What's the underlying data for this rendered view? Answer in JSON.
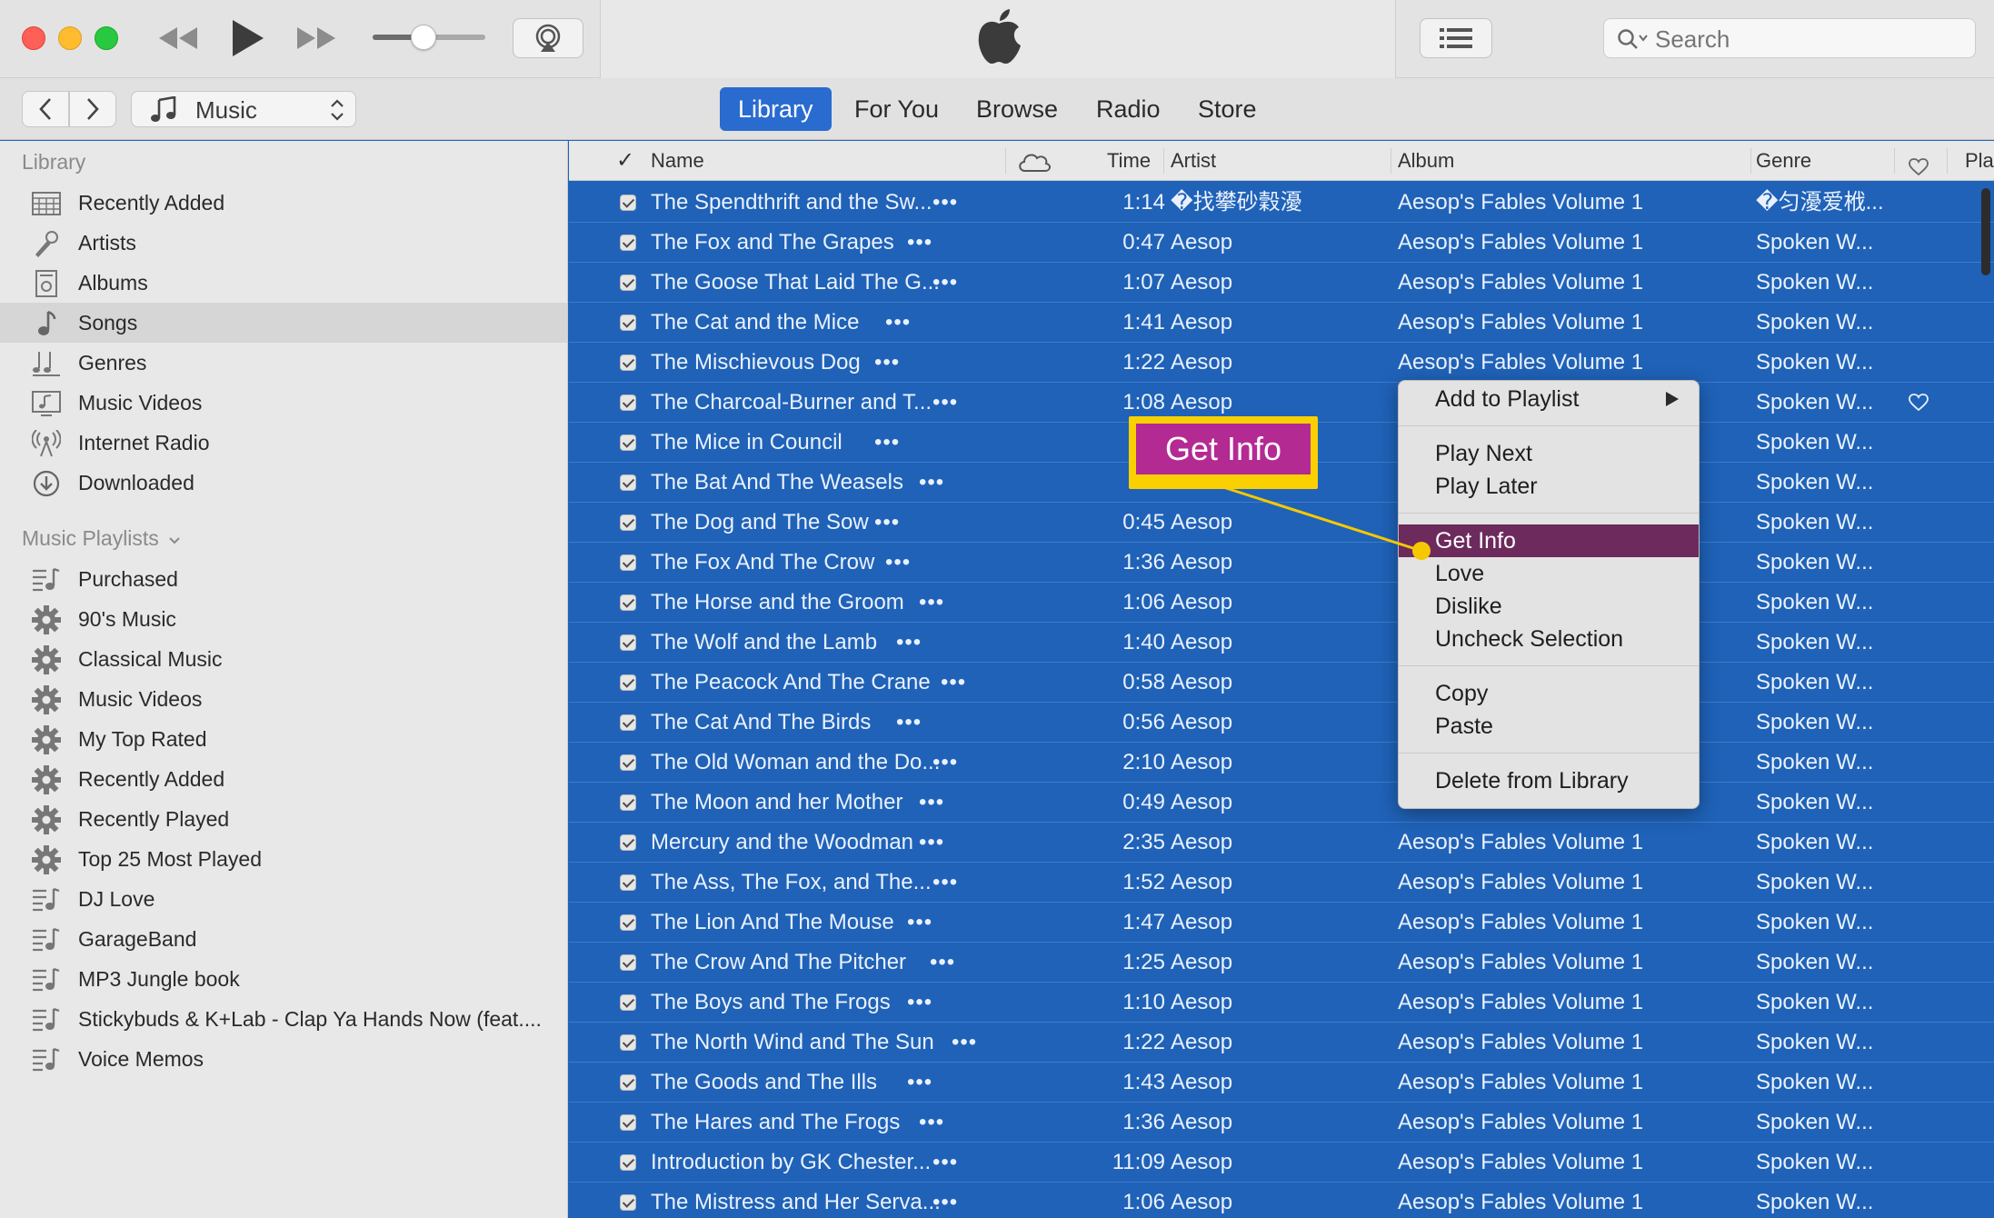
{
  "toolbar": {
    "search": {
      "placeholder": "Search",
      "value": ""
    },
    "volume": 0.45
  },
  "navbar": {
    "media": "Music",
    "tabs": [
      {
        "label": "Library",
        "active": true
      },
      {
        "label": "For You",
        "active": false
      },
      {
        "label": "Browse",
        "active": false
      },
      {
        "label": "Radio",
        "active": false
      },
      {
        "label": "Store",
        "active": false
      }
    ]
  },
  "sidebar": {
    "library_header": "Library",
    "library_items": [
      {
        "label": "Recently Added",
        "icon": "calendar-grid-icon"
      },
      {
        "label": "Artists",
        "icon": "microphone-icon"
      },
      {
        "label": "Albums",
        "icon": "album-icon"
      },
      {
        "label": "Songs",
        "icon": "music-note-icon",
        "selected": true
      },
      {
        "label": "Genres",
        "icon": "genres-icon"
      },
      {
        "label": "Music Videos",
        "icon": "music-video-icon"
      },
      {
        "label": "Internet Radio",
        "icon": "radio-antenna-icon"
      },
      {
        "label": "Downloaded",
        "icon": "download-circle-icon"
      }
    ],
    "playlists_header": "Music Playlists",
    "playlists": [
      {
        "label": "Purchased",
        "icon": "playlist-icon"
      },
      {
        "label": "90's Music",
        "icon": "smart-playlist-gear-icon"
      },
      {
        "label": "Classical Music",
        "icon": "smart-playlist-gear-icon"
      },
      {
        "label": "Music Videos",
        "icon": "smart-playlist-gear-icon"
      },
      {
        "label": "My Top Rated",
        "icon": "smart-playlist-gear-icon"
      },
      {
        "label": "Recently Added",
        "icon": "smart-playlist-gear-icon"
      },
      {
        "label": "Recently Played",
        "icon": "smart-playlist-gear-icon"
      },
      {
        "label": "Top 25 Most Played",
        "icon": "smart-playlist-gear-icon"
      },
      {
        "label": "DJ Love",
        "icon": "playlist-icon"
      },
      {
        "label": "GarageBand",
        "icon": "playlist-icon"
      },
      {
        "label": "MP3 Jungle book",
        "icon": "playlist-icon"
      },
      {
        "label": "Stickybuds & K+Lab - Clap Ya Hands Now (feat....",
        "icon": "playlist-icon"
      },
      {
        "label": "Voice Memos",
        "icon": "playlist-icon"
      }
    ]
  },
  "columns": {
    "check": "✓",
    "name": "Name",
    "time": "Time",
    "artist": "Artist",
    "album": "Album",
    "genre": "Genre",
    "plays": "Pla"
  },
  "songs": [
    {
      "name": "The Spendthrift and the Sw...",
      "time": "1:14",
      "artist": "�找攀砂穀瀀",
      "album": "Aesop's Fables Volume 1",
      "genre": "�匀瀀爱栰..."
    },
    {
      "name": "The Fox and The Grapes",
      "time": "0:47",
      "artist": "Aesop",
      "album": "Aesop's Fables Volume 1",
      "genre": "Spoken W..."
    },
    {
      "name": "The Goose That Laid The G...",
      "time": "1:07",
      "artist": "Aesop",
      "album": "Aesop's Fables Volume 1",
      "genre": "Spoken W..."
    },
    {
      "name": "The Cat and the Mice",
      "time": "1:41",
      "artist": "Aesop",
      "album": "Aesop's Fables Volume 1",
      "genre": "Spoken W..."
    },
    {
      "name": "The Mischievous Dog",
      "time": "1:22",
      "artist": "Aesop",
      "album": "Aesop's Fables Volume 1",
      "genre": "Spoken W..."
    },
    {
      "name": "The Charcoal-Burner and T...",
      "time": "1:08",
      "artist": "Aesop",
      "album": "",
      "genre": "Spoken W...",
      "loved": true
    },
    {
      "name": "The Mice in Council",
      "time": "1:",
      "artist": "",
      "album": "",
      "genre": "Spoken W..."
    },
    {
      "name": "The Bat And The Weasels",
      "time": "1:",
      "artist": "",
      "album": "",
      "genre": "Spoken W..."
    },
    {
      "name": "The Dog and The Sow",
      "time": "0:45",
      "artist": "Aesop",
      "album": "",
      "genre": "Spoken W..."
    },
    {
      "name": "The Fox And The Crow",
      "time": "1:36",
      "artist": "Aesop",
      "album": "",
      "genre": "Spoken W..."
    },
    {
      "name": "The Horse and the Groom",
      "time": "1:06",
      "artist": "Aesop",
      "album": "",
      "genre": "Spoken W..."
    },
    {
      "name": "The Wolf and the Lamb",
      "time": "1:40",
      "artist": "Aesop",
      "album": "",
      "genre": "Spoken W..."
    },
    {
      "name": "The Peacock And The Crane",
      "time": "0:58",
      "artist": "Aesop",
      "album": "",
      "genre": "Spoken W..."
    },
    {
      "name": "The Cat And The Birds",
      "time": "0:56",
      "artist": "Aesop",
      "album": "",
      "genre": "Spoken W..."
    },
    {
      "name": "The Old Woman and the Do...",
      "time": "2:10",
      "artist": "Aesop",
      "album": "",
      "genre": "Spoken W..."
    },
    {
      "name": "The Moon and her Mother",
      "time": "0:49",
      "artist": "Aesop",
      "album": "",
      "genre": "Spoken W..."
    },
    {
      "name": "Mercury and the Woodman",
      "time": "2:35",
      "artist": "Aesop",
      "album": "Aesop's Fables Volume 1",
      "genre": "Spoken W..."
    },
    {
      "name": "The Ass, The Fox, and The...",
      "time": "1:52",
      "artist": "Aesop",
      "album": "Aesop's Fables Volume 1",
      "genre": "Spoken W..."
    },
    {
      "name": "The Lion And The Mouse",
      "time": "1:47",
      "artist": "Aesop",
      "album": "Aesop's Fables Volume 1",
      "genre": "Spoken W..."
    },
    {
      "name": "The Crow And The Pitcher",
      "time": "1:25",
      "artist": "Aesop",
      "album": "Aesop's Fables Volume 1",
      "genre": "Spoken W..."
    },
    {
      "name": "The Boys and The Frogs",
      "time": "1:10",
      "artist": "Aesop",
      "album": "Aesop's Fables Volume 1",
      "genre": "Spoken W..."
    },
    {
      "name": "The North Wind and The Sun",
      "time": "1:22",
      "artist": "Aesop",
      "album": "Aesop's Fables Volume 1",
      "genre": "Spoken W..."
    },
    {
      "name": "The Goods and The Ills",
      "time": "1:43",
      "artist": "Aesop",
      "album": "Aesop's Fables Volume 1",
      "genre": "Spoken W..."
    },
    {
      "name": "The Hares and The Frogs",
      "time": "1:36",
      "artist": "Aesop",
      "album": "Aesop's Fables Volume 1",
      "genre": "Spoken W..."
    },
    {
      "name": "Introduction by GK Chester...",
      "time": "11:09",
      "artist": "Aesop",
      "album": "Aesop's Fables Volume 1",
      "genre": "Spoken W..."
    },
    {
      "name": "The Mistress and Her Serva...",
      "time": "1:06",
      "artist": "Aesop",
      "album": "Aesop's Fables Volume 1",
      "genre": "Spoken W..."
    }
  ],
  "context_menu": {
    "groups": [
      [
        {
          "label": "Add to Playlist",
          "submenu": true
        }
      ],
      [
        {
          "label": "Play Next"
        },
        {
          "label": "Play Later"
        }
      ],
      [
        {
          "label": "Get Info",
          "highlighted": true
        },
        {
          "label": "Love"
        },
        {
          "label": "Dislike"
        },
        {
          "label": "Uncheck Selection"
        }
      ],
      [
        {
          "label": "Copy"
        },
        {
          "label": "Paste"
        }
      ],
      [
        {
          "label": "Delete from Library"
        }
      ]
    ]
  },
  "callout": {
    "label": "Get Info"
  },
  "colors": {
    "selection": "#1f62b8",
    "menu_highlight": "#6d2a5d",
    "callout_border": "#fbd000",
    "callout_fill": "#b42a93"
  }
}
